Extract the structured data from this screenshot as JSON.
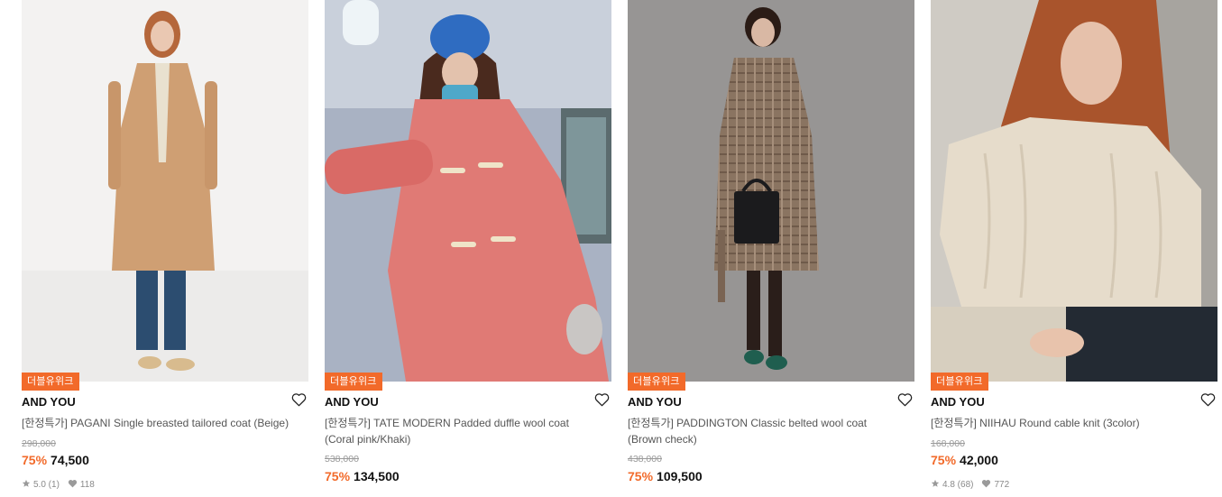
{
  "products": [
    {
      "badge": "더블유위크",
      "brand": "AND YOU",
      "name": "[한정특가] PAGANI Single breasted tailored coat (Beige)",
      "original_price": "298,000",
      "discount": "75%",
      "price": "74,500",
      "rating": "5.0 (1)",
      "likes": "118"
    },
    {
      "badge": "더블유위크",
      "brand": "AND YOU",
      "name": "[한정특가] TATE MODERN Padded duffle wool coat (Coral pink/Khaki)",
      "original_price": "538,000",
      "discount": "75%",
      "price": "134,500"
    },
    {
      "badge": "더블유위크",
      "brand": "AND YOU",
      "name": "[한정특가] PADDINGTON Classic belted wool coat (Brown check)",
      "original_price": "438,000",
      "discount": "75%",
      "price": "109,500"
    },
    {
      "badge": "더블유위크",
      "brand": "AND YOU",
      "name": "[한정특가] NIIHAU Round cable knit (3color)",
      "original_price": "168,000",
      "discount": "75%",
      "price": "42,000",
      "rating": "4.8 (68)",
      "likes": "772"
    }
  ],
  "colors": {
    "accent": "#f26a2a",
    "price": "#111111",
    "muted": "#9a9a9a"
  },
  "icons": {
    "wishlist": "heart-outline-icon",
    "rating": "star-icon",
    "likes": "heart-filled-icon"
  }
}
